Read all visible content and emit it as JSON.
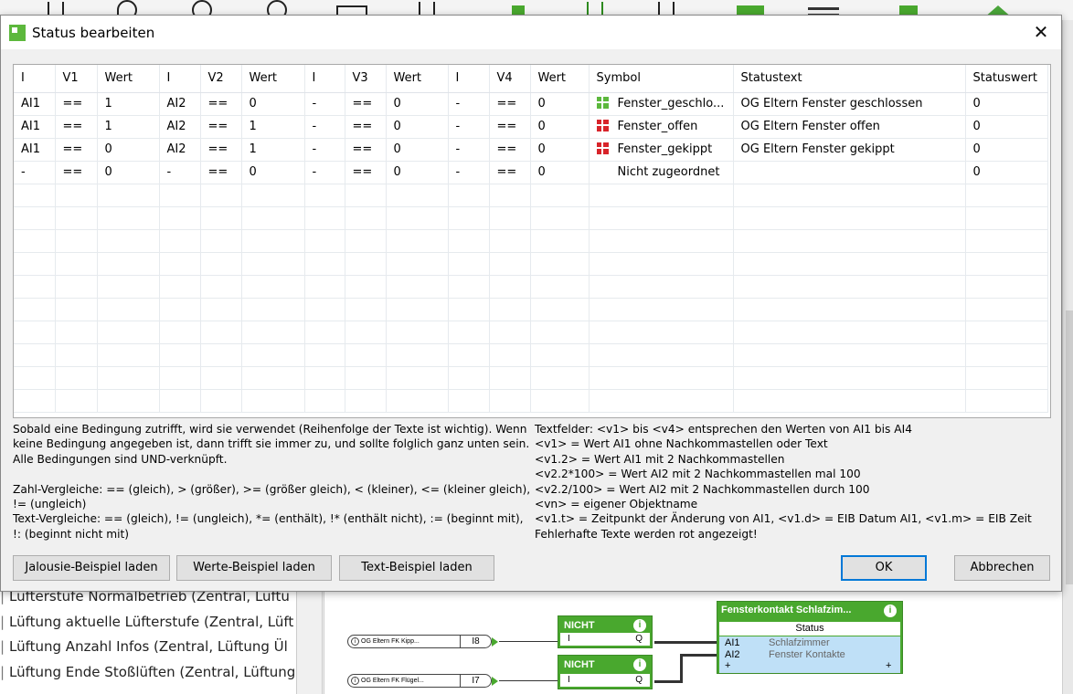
{
  "dialog": {
    "title": "Status bearbeiten",
    "close": "✕"
  },
  "table": {
    "headers": [
      "I",
      "V1",
      "Wert",
      "I",
      "V2",
      "Wert",
      "I",
      "V3",
      "Wert",
      "I",
      "V4",
      "Wert",
      "Symbol",
      "Statustext",
      "Statuswert"
    ],
    "rows": [
      [
        "AI1",
        "==",
        "1",
        "AI2",
        "==",
        "0",
        "-",
        "==",
        "0",
        "-",
        "==",
        "0",
        "Fenster_geschlo...",
        "OG Eltern Fenster geschlossen",
        "0"
      ],
      [
        "AI1",
        "==",
        "1",
        "AI2",
        "==",
        "1",
        "-",
        "==",
        "0",
        "-",
        "==",
        "0",
        "Fenster_offen",
        "OG Eltern Fenster offen",
        "0"
      ],
      [
        "AI1",
        "==",
        "0",
        "AI2",
        "==",
        "1",
        "-",
        "==",
        "0",
        "-",
        "==",
        "0",
        "Fenster_gekippt",
        "OG Eltern Fenster gekippt",
        "0"
      ],
      [
        "-",
        "==",
        "0",
        "-",
        "==",
        "0",
        "-",
        "==",
        "0",
        "-",
        "==",
        "0",
        "Nicht zugeordnet",
        "",
        "0"
      ]
    ],
    "symbol_colors": [
      "green",
      "red",
      "red",
      "none"
    ],
    "empty_rows": 10
  },
  "help": {
    "left": [
      "Sobald eine Bedingung zutrifft, wird sie verwendet (Reihenfolge der Texte ist wichtig). Wenn",
      "keine Bedingung angegeben ist, dann trifft sie immer zu, und sollte folglich ganz unten sein.",
      "Alle Bedingungen sind UND-verknüpft.",
      "",
      "Zahl-Vergleiche: == (gleich), > (größer), >= (größer gleich), < (kleiner), <= (kleiner gleich),",
      "!= (ungleich)",
      "Text-Vergleiche: == (gleich), != (ungleich), *= (enthält), !* (enthält nicht), := (beginnt mit),",
      "!: (beginnt nicht mit)"
    ],
    "right": [
      "Textfelder: <v1> bis <v4> entsprechen den Werten von AI1 bis AI4",
      "<v1> = Wert AI1 ohne Nachkommastellen oder Text",
      "<v1.2> = Wert AI1 mit 2 Nachkommastellen",
      "<v2.2*100> = Wert AI2 mit 2 Nachkommastellen mal 100",
      "<v2.2/100> = Wert AI2 mit 2 Nachkommastellen durch 100",
      "<vn> = eigener Objektname",
      "<v1.t> = Zeitpunkt der Änderung von AI1, <v1.d> = EIB Datum AI1, <v1.m> = EIB Zeit",
      "Fehlerhafte Texte werden rot angezeigt!"
    ]
  },
  "buttons": {
    "jalousie": "Jalousie-Beispiel laden",
    "werte": "Werte-Beispiel laden",
    "text": "Text-Beispiel laden",
    "ok": "OK",
    "abbrechen": "Abbrechen"
  },
  "background": {
    "list_items": [
      "Lüfterstufe Normalbetrieb (Zentral, Lüftu",
      "Lüftung aktuelle Lüfterstufe (Zentral, Lüft",
      "Lüftung Anzahl Infos (Zentral, Lüftung Ül",
      "Lüftung Ende Stoßlüften (Zentral, Lüftung"
    ],
    "inputs": [
      {
        "label": "OG Eltern FK Kipp...",
        "pin": "I8"
      },
      {
        "label": "OG Eltern FK Flügel...",
        "pin": "I7"
      }
    ],
    "nicht_title": "NICHT",
    "nicht_in": "I",
    "nicht_out": "Q",
    "node_title": "Fensterkontakt Schlafzim...",
    "node_status": "Status",
    "node_in1": "AI1",
    "node_in1_val": "Schlafzimmer",
    "node_in2": "AI2",
    "node_in2_val": "Fenster Kontakte",
    "node_plus": "+",
    "info_glyph": "i"
  }
}
